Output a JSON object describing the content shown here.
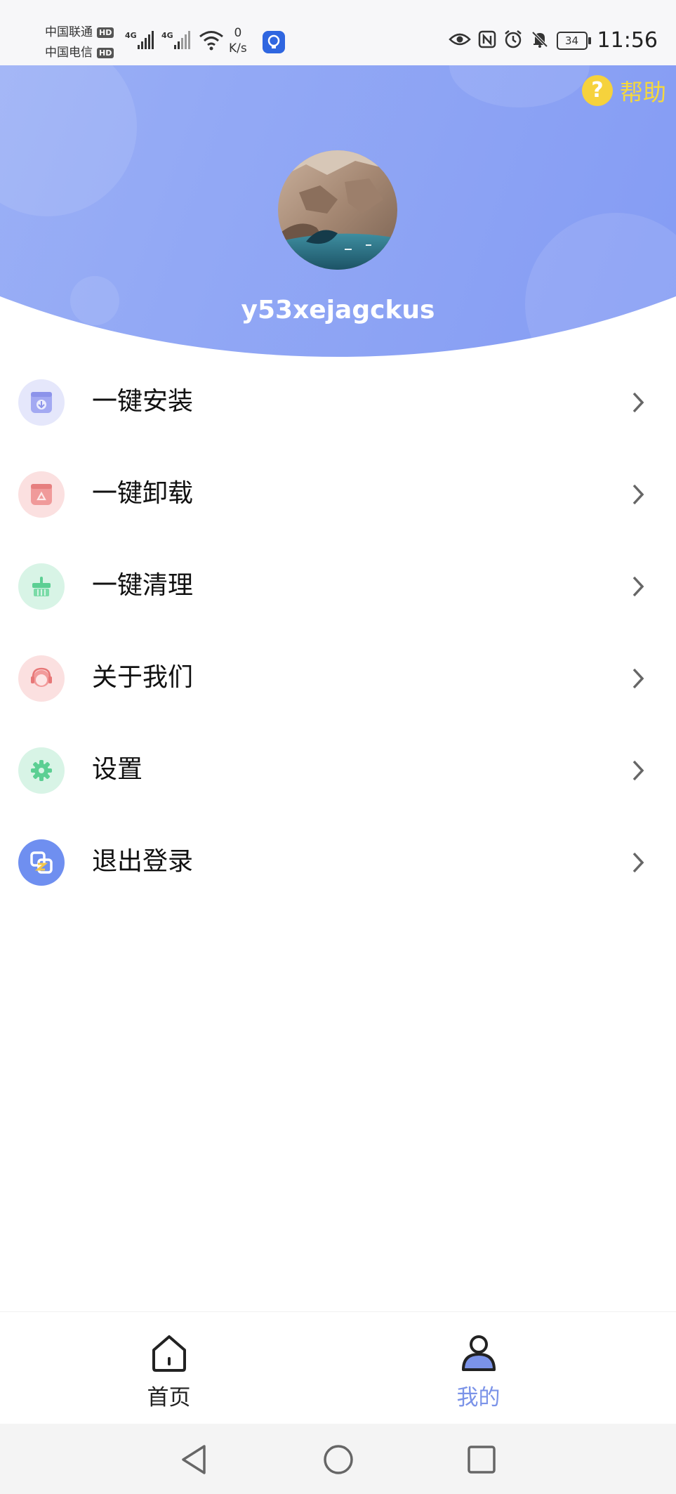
{
  "status_bar": {
    "carrier1": "中国联通",
    "carrier2": "中国电信",
    "hd_badge": "HD",
    "network1": "4G",
    "network2": "4G",
    "speed_value": "0",
    "speed_unit": "K/s",
    "battery": "34",
    "time": "11:56"
  },
  "header": {
    "help_symbol": "?",
    "help_label": "帮助",
    "username": "y53xejagckus"
  },
  "menu": {
    "items": [
      {
        "label": "一键安装",
        "icon": "install-icon"
      },
      {
        "label": "一键卸载",
        "icon": "uninstall-icon"
      },
      {
        "label": "一键清理",
        "icon": "clean-broom-icon"
      },
      {
        "label": "关于我们",
        "icon": "customer-service-icon"
      },
      {
        "label": "设置",
        "icon": "gear-icon"
      },
      {
        "label": "退出登录",
        "icon": "logout-icon"
      }
    ]
  },
  "tabs": [
    {
      "label": "首页",
      "icon": "home-icon",
      "active": false
    },
    {
      "label": "我的",
      "icon": "profile-icon",
      "active": true
    }
  ],
  "colors": {
    "accent": "#7b93f0",
    "help": "#f4d83f",
    "tab_active": "#7b93e8",
    "tab_inactive": "#222222"
  }
}
